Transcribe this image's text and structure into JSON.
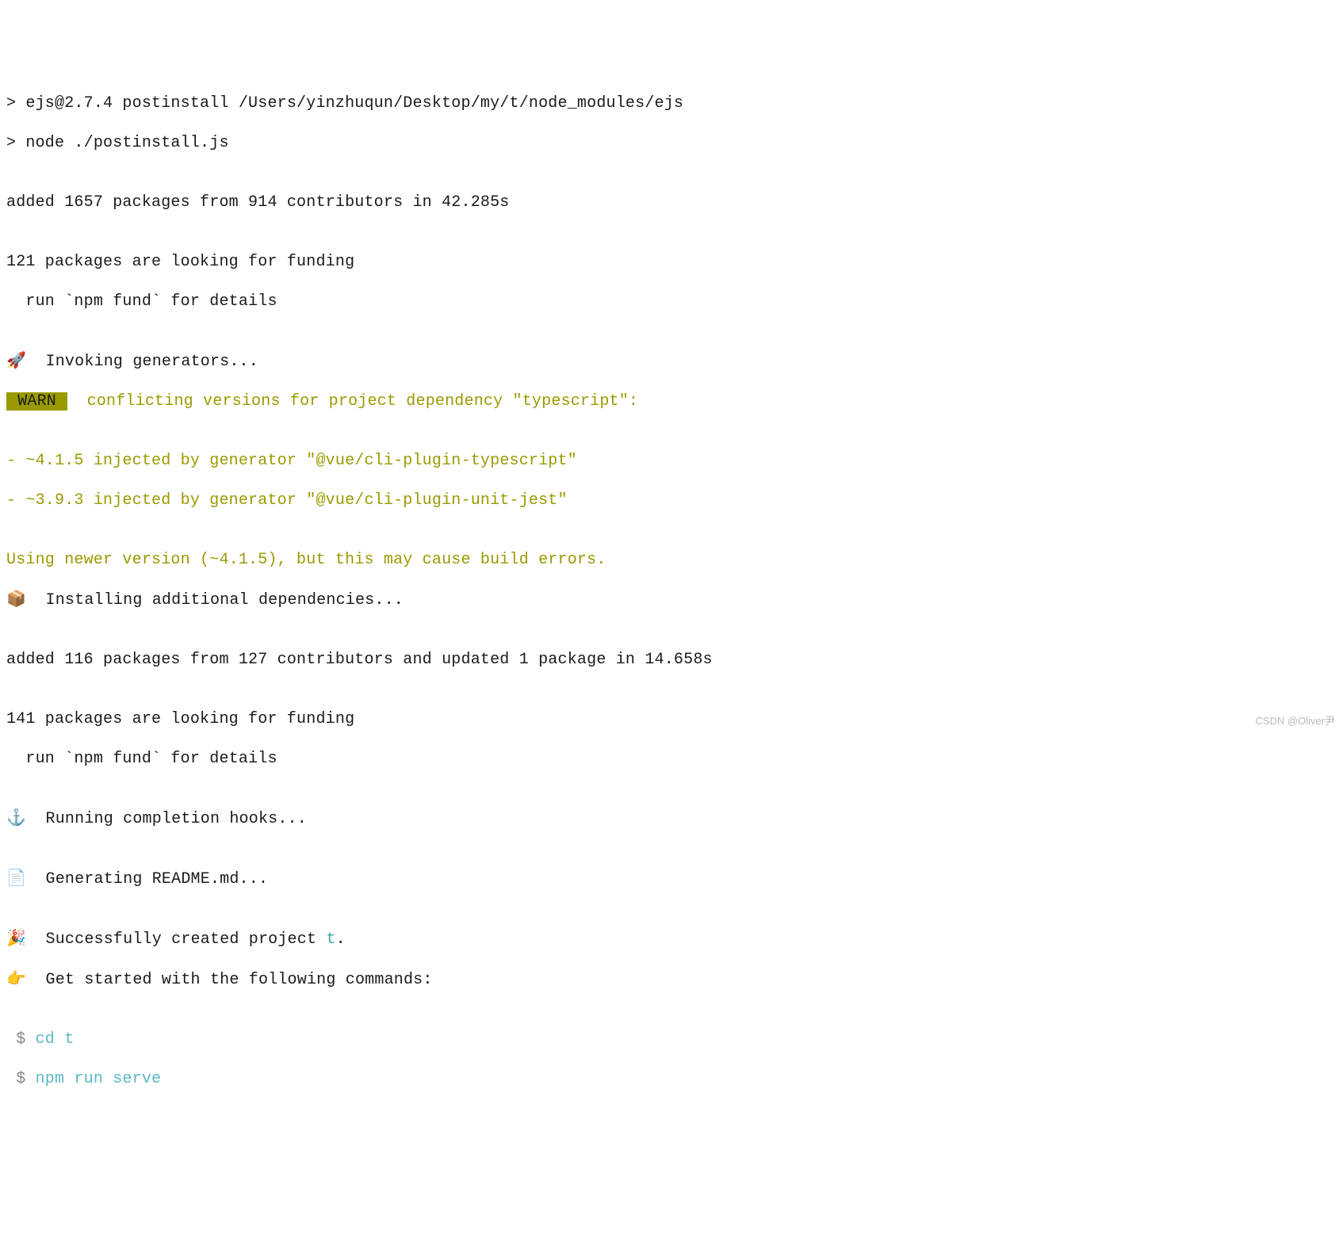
{
  "lines": {
    "l1": "> ejs@2.7.4 postinstall /Users/yinzhuqun/Desktop/my/t/node_modules/ejs",
    "l2": "> node ./postinstall.js",
    "blank": "",
    "l3": "added 1657 packages from 914 contributors in 42.285s",
    "l4": "121 packages are looking for funding",
    "l5": "  run `npm fund` for details",
    "invoking_emoji": "🚀",
    "invoking": "  Invoking generators...",
    "warn_label": " WARN ",
    "warn_msg": "  conflicting versions for project dependency \"typescript\":",
    "dep1": "- ~4.1.5 injected by generator \"@vue/cli-plugin-typescript\"",
    "dep2": "- ~3.9.3 injected by generator \"@vue/cli-plugin-unit-jest\"",
    "using": "Using newer version (~4.1.5), but this may cause build errors.",
    "install_emoji": "📦",
    "install": "  Installing additional dependencies...",
    "added2": "added 116 packages from 127 contributors and updated 1 package in 14.658s",
    "fund2a": "141 packages are looking for funding",
    "fund2b": "  run `npm fund` for details",
    "anchor_emoji": "⚓",
    "hooks": "  Running completion hooks...",
    "page_emoji": "📄",
    "readme": "  Generating README.md...",
    "party_emoji": "🎉",
    "success_pre": "  Successfully created project ",
    "success_proj": "t",
    "success_post": ".",
    "point_emoji": "👉",
    "getstarted": "  Get started with the following commands:",
    "prompt": " $ ",
    "cmd1": "cd t",
    "cmd2": "npm run serve"
  },
  "attribution": "CSDN @Oliver尹"
}
